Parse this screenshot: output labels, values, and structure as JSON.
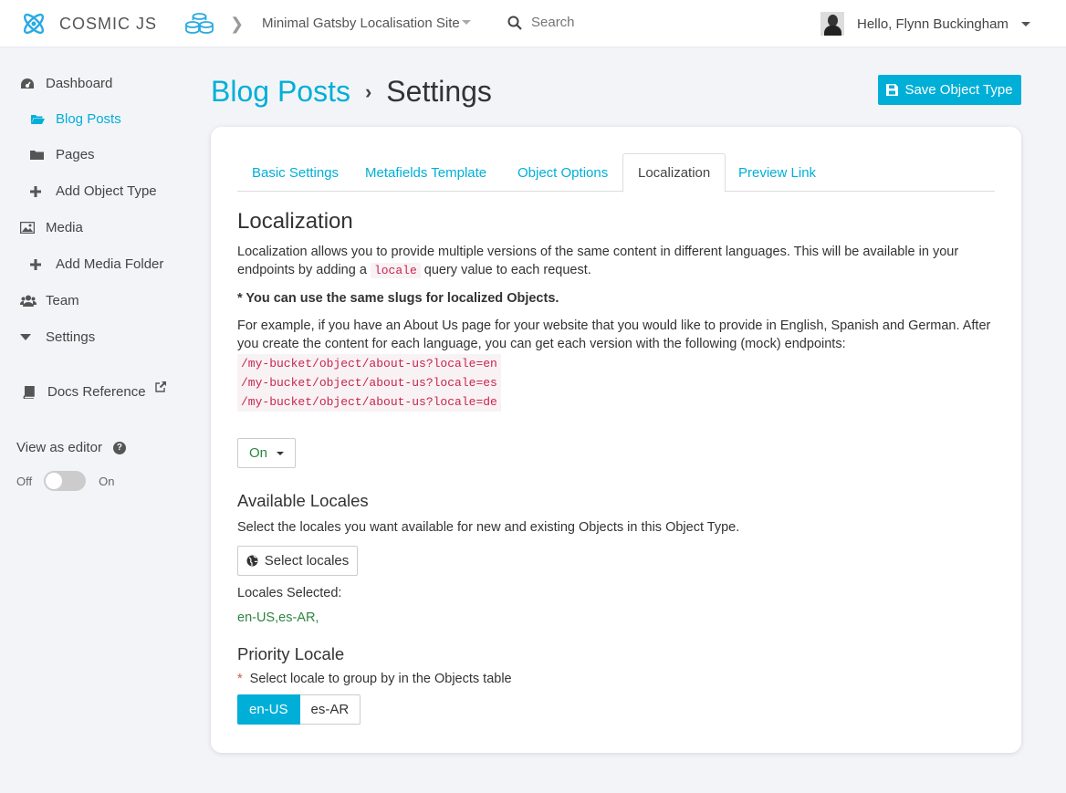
{
  "brand": {
    "name": "COSMIC JS",
    "accent": "#00afd7"
  },
  "topbar": {
    "bucket_name": "Minimal Gatsby Localisation Site",
    "search_placeholder": "Search",
    "greeting": "Hello, Flynn Buckingham"
  },
  "sidebar": {
    "items": [
      {
        "label": "Dashboard",
        "icon": "dashboard-icon"
      },
      {
        "label": "Blog Posts",
        "icon": "folder-open-icon",
        "active": true
      },
      {
        "label": "Pages",
        "icon": "folder-icon"
      },
      {
        "label": "Add Object Type",
        "icon": "plus-icon"
      },
      {
        "label": "Media",
        "icon": "image-icon"
      },
      {
        "label": "Add Media Folder",
        "icon": "plus-icon"
      },
      {
        "label": "Team",
        "icon": "users-icon"
      },
      {
        "label": "Settings",
        "icon": "caret-down-icon"
      },
      {
        "label": "Docs Reference",
        "icon": "book-icon"
      }
    ],
    "view_as_editor": "View as editor",
    "toggle_off": "Off",
    "toggle_on": "On"
  },
  "header": {
    "crumb_link": "Blog Posts",
    "crumb_current": "Settings",
    "save_label": "Save Object Type"
  },
  "tabs": [
    {
      "label": "Basic Settings"
    },
    {
      "label": "Metafields Template"
    },
    {
      "label": "Object Options"
    },
    {
      "label": "Localization",
      "active": true
    },
    {
      "label": "Preview Link"
    }
  ],
  "localization": {
    "title": "Localization",
    "intro_part1": "Localization allows you to provide multiple versions of the same content in different languages. This will be available in your endpoints by adding a",
    "intro_code": "locale",
    "intro_part2": "query value to each request.",
    "slugs_note": "* You can use the same slugs for localized Objects.",
    "example_text": "For example, if you have an About Us page for your website that you would like to provide in English, Spanish and German. After you create the content for each language, you can get each version with the following (mock) endpoints:",
    "endpoints": [
      "/my-bucket/object/about-us?locale=en",
      "/my-bucket/object/about-us?locale=es",
      "/my-bucket/object/about-us?locale=de"
    ],
    "enabled_value": "On"
  },
  "available_locales": {
    "title": "Available Locales",
    "description": "Select the locales you want available for new and existing Objects in this Object Type.",
    "button_label": "Select locales",
    "selected_label": "Locales Selected:",
    "selected_value": "en-US,es-AR,"
  },
  "priority_locale": {
    "title": "Priority Locale",
    "description": "Select locale to group by in the Objects table",
    "required_mark": "*",
    "options": [
      "en-US",
      "es-AR"
    ],
    "selected": "en-US"
  }
}
